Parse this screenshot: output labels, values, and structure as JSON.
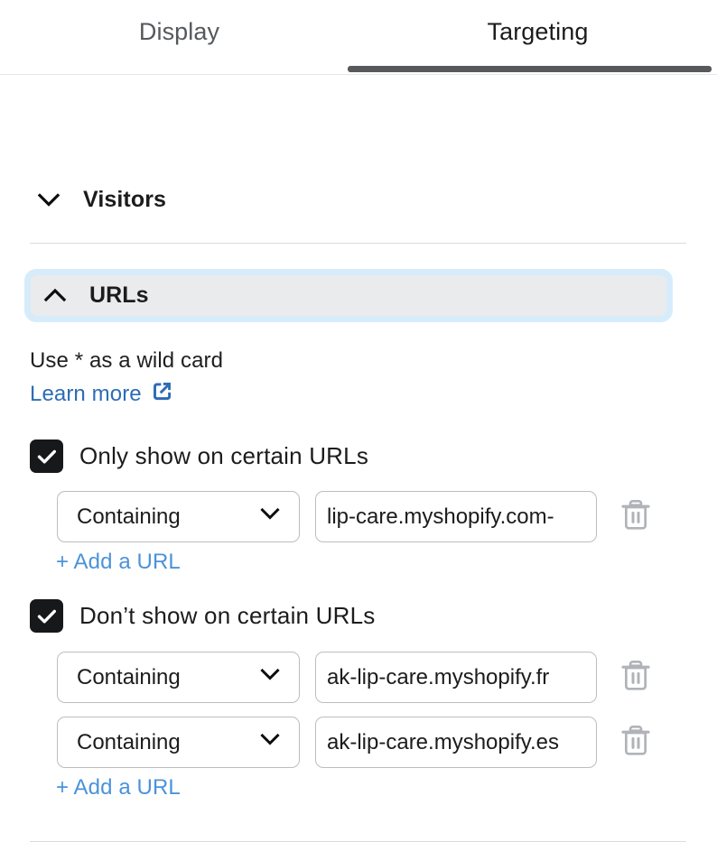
{
  "tabs": [
    {
      "label": "Display",
      "active": false
    },
    {
      "label": "Targeting",
      "active": true
    }
  ],
  "sections": {
    "visitors": {
      "title": "Visitors",
      "caret_icon": "chevron-down-icon",
      "expanded": false
    },
    "urls": {
      "title": "URLs",
      "caret_icon": "chevron-up-icon",
      "expanded": true,
      "hint": "Use * as a wild card",
      "learn_more": {
        "label": "Learn more",
        "icon": "external-link-icon"
      },
      "groups": [
        {
          "checkbox_label": "Only show on certain URLs",
          "checked": true,
          "checkbox_icon": "checkmark-icon",
          "rules": [
            {
              "match_type": "Containing",
              "match_icon": "chevron-down-icon",
              "url": "-lip-care.myshopify.com",
              "delete_icon": "trash-icon"
            }
          ],
          "add_label": "+ Add a URL"
        },
        {
          "checkbox_label": "Don’t show on certain URLs",
          "checked": true,
          "checkbox_icon": "checkmark-icon",
          "rules": [
            {
              "match_type": "Containing",
              "match_icon": "chevron-down-icon",
              "url": "ak-lip-care.myshopify.fr",
              "delete_icon": "trash-icon"
            },
            {
              "match_type": "Containing",
              "match_icon": "chevron-down-icon",
              "url": "ak-lip-care.myshopify.es",
              "delete_icon": "trash-icon"
            }
          ],
          "add_label": "+ Add a URL"
        }
      ]
    }
  },
  "colors": {
    "tab_indicator": "#57595c",
    "focus_ring": "#d7ecfb",
    "section_header_bg": "#eaebec",
    "link": "#2d6cb5",
    "add_link": "#4b93d9",
    "checkbox_bg": "#16181a",
    "trash_icon": "#b0b3b8",
    "border": "#bdbdbe",
    "divider": "#dcdcdd"
  }
}
